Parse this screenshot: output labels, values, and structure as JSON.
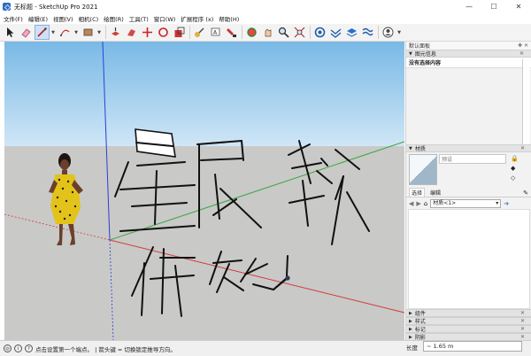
{
  "window": {
    "title": "无标题 - SketchUp Pro 2021",
    "minimize": "—",
    "maximize": "☐",
    "close": "✕"
  },
  "menu": [
    "文件(F)",
    "编辑(E)",
    "视图(V)",
    "相机(C)",
    "绘图(R)",
    "工具(T)",
    "窗口(W)",
    "扩展程序 (x)",
    "帮助(H)"
  ],
  "toolbar": {
    "tools": [
      "select-icon",
      "eraser-icon",
      "line-icon",
      "arc-icon",
      "rectangle-icon",
      "pushpull-icon",
      "followme-icon",
      "move-icon",
      "rotate-icon",
      "scale-icon",
      "tape-icon",
      "text-icon",
      "paint-icon",
      "orbit-icon",
      "pan-icon",
      "zoom-icon",
      "zoom-extents-icon",
      "warehouse-icon",
      "extension-icon",
      "layers-icon",
      "sandbox-icon",
      "account-icon"
    ],
    "active_tool": "line-icon"
  },
  "tray": {
    "title": "默认面板",
    "entity_panel": {
      "title": "图元信息",
      "empty_text": "没有选择内容"
    },
    "materials_panel": {
      "title": "材质",
      "default_label": "预设",
      "tabs": [
        "选择",
        "编辑"
      ],
      "material_dropdown": "材质<1>"
    },
    "collapsed_panels": [
      "组件",
      "样式",
      "标记",
      "阴影"
    ]
  },
  "status": {
    "hint": "点击设置第一个端点。  | 箭头键 = 切换锁定推导方向。",
    "vcb_label": "长度",
    "vcb_value": "~ 1.65 m"
  },
  "colors": {
    "sky_top": "#79b9e6",
    "ground": "#c9c9c8",
    "axis_red": "#d23a3a",
    "axis_green": "#3aa63a",
    "axis_blue": "#2a3fd6",
    "active_tool_bg": "#cfe0f5"
  }
}
